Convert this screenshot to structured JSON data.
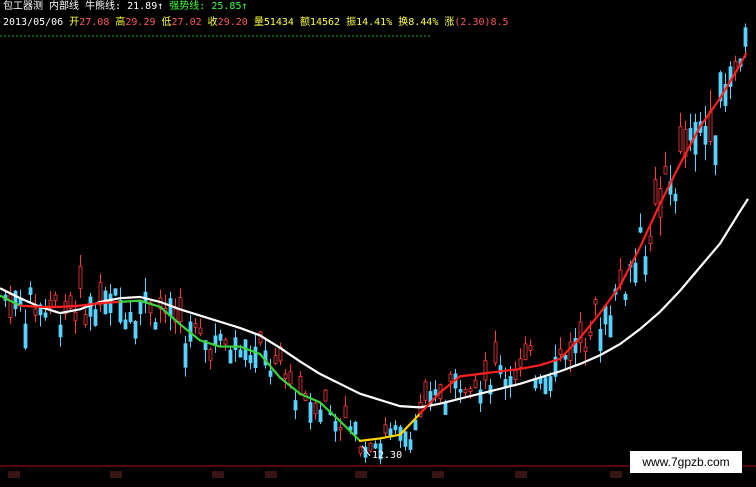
{
  "header": {
    "stock_name": "包工器测",
    "indicator_name": "内部线",
    "bull_label": "牛熊线:",
    "bull_value": "21.89",
    "bull_arrow": "↑",
    "strong_label": "强势线:",
    "strong_value": "25.85",
    "strong_arrow": "↑",
    "date": "2013/05/06",
    "open_label": "开",
    "open_value": "27.08",
    "high_label": "高",
    "high_value": "29.29",
    "low_label": "低",
    "low_value": "27.02",
    "close_label": "收",
    "close_value": "29.20",
    "volume_label": "量",
    "volume_value": "51434",
    "amount_label": "额",
    "amount_value": "14562",
    "amp_label": "振",
    "amp_value": "14.41%",
    "turnover_label": "换",
    "turnover_value": "8.44%",
    "change_label": "涨",
    "change_value": "(2.30)8.5"
  },
  "low_marker": "12.30",
  "watermark": "www.7gpzb.com",
  "colors": {
    "background": "#000000",
    "up_candle": "#ff3c3c",
    "down_candle": "#5ad2ff",
    "long_ma": "#ffffff",
    "short_ma_up": "#ff2020",
    "short_ma_down": "#3cd23c",
    "short_ma_transition": "#ffd200"
  },
  "chart_data": {
    "type": "line",
    "xlabel": "",
    "ylabel": "",
    "long_ma": [
      [
        0,
        22.0
      ],
      [
        20,
        21.2
      ],
      [
        40,
        20.5
      ],
      [
        60,
        20.0
      ],
      [
        80,
        20.3
      ],
      [
        100,
        20.9
      ],
      [
        120,
        21.2
      ],
      [
        140,
        21.3
      ],
      [
        160,
        20.9
      ],
      [
        180,
        20.3
      ],
      [
        200,
        19.8
      ],
      [
        220,
        19.3
      ],
      [
        240,
        18.8
      ],
      [
        260,
        18.2
      ],
      [
        280,
        17.2
      ],
      [
        300,
        16.1
      ],
      [
        320,
        15.1
      ],
      [
        340,
        14.3
      ],
      [
        360,
        13.5
      ],
      [
        380,
        13.0
      ],
      [
        400,
        12.5
      ],
      [
        420,
        12.4
      ],
      [
        440,
        12.7
      ],
      [
        460,
        13.1
      ],
      [
        480,
        13.5
      ],
      [
        500,
        13.9
      ],
      [
        520,
        14.3
      ],
      [
        540,
        14.8
      ],
      [
        560,
        15.3
      ],
      [
        580,
        15.9
      ],
      [
        600,
        16.6
      ],
      [
        620,
        17.5
      ],
      [
        640,
        18.7
      ],
      [
        660,
        20.1
      ],
      [
        680,
        21.8
      ],
      [
        700,
        23.7
      ],
      [
        720,
        25.6
      ],
      [
        740,
        28.2
      ],
      [
        748,
        29.2
      ]
    ],
    "short_ma": [
      [
        0,
        21.4
      ],
      [
        20,
        20.6
      ],
      [
        40,
        20.5
      ],
      [
        60,
        20.5
      ],
      [
        80,
        20.6
      ],
      [
        100,
        20.8
      ],
      [
        120,
        20.9
      ],
      [
        140,
        21.0
      ],
      [
        160,
        20.5
      ],
      [
        180,
        19.1
      ],
      [
        200,
        17.8
      ],
      [
        220,
        17.3
      ],
      [
        240,
        17.3
      ],
      [
        260,
        16.7
      ],
      [
        280,
        14.8
      ],
      [
        300,
        13.5
      ],
      [
        320,
        12.8
      ],
      [
        340,
        11.3
      ],
      [
        360,
        9.7
      ],
      [
        380,
        9.9
      ],
      [
        400,
        10.2
      ],
      [
        420,
        11.9
      ],
      [
        440,
        13.6
      ],
      [
        460,
        14.9
      ],
      [
        480,
        15.1
      ],
      [
        500,
        15.3
      ],
      [
        520,
        15.5
      ],
      [
        540,
        15.8
      ],
      [
        560,
        16.3
      ],
      [
        580,
        18.0
      ],
      [
        600,
        20.0
      ],
      [
        620,
        22.2
      ],
      [
        640,
        25.3
      ],
      [
        660,
        28.8
      ],
      [
        680,
        32.0
      ],
      [
        700,
        35.0
      ],
      [
        720,
        37.3
      ],
      [
        740,
        40.0
      ],
      [
        746,
        40.9
      ]
    ],
    "candles_range": [
      [
        0,
        18.9,
        23.0
      ],
      [
        748,
        28.0,
        41.5
      ]
    ],
    "low_point": {
      "x": 370,
      "y": 12.3
    },
    "ylim": [
      8.0,
      42.0
    ]
  }
}
